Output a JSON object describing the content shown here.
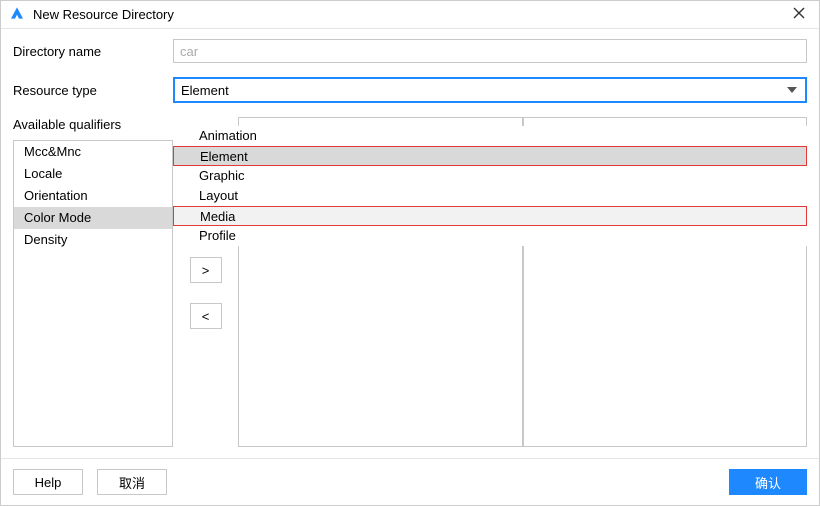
{
  "titlebar": {
    "title": "New Resource Directory"
  },
  "form": {
    "dir_name_label": "Directory name",
    "dir_name_placeholder": "car",
    "res_type_label": "Resource type",
    "res_type_selected": "Element"
  },
  "dropdown": {
    "items": [
      "Animation",
      "Element",
      "Graphic",
      "Layout",
      "Media",
      "Profile"
    ]
  },
  "qualifiers": {
    "label": "Available qualifiers",
    "items": [
      "Mcc&Mnc",
      "Locale",
      "Orientation",
      "Color Mode",
      "Density"
    ]
  },
  "arrows": {
    "right": ">",
    "left": "<"
  },
  "footer": {
    "help": "Help",
    "cancel": "取消",
    "ok": "确认"
  }
}
